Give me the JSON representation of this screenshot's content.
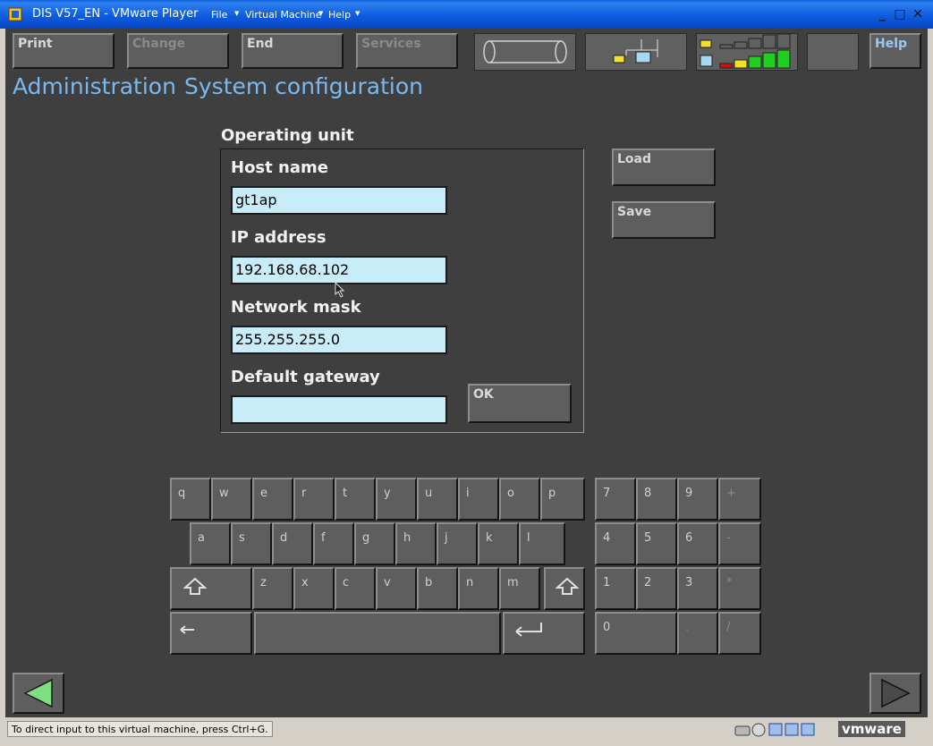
{
  "window": {
    "title": "DIS V57_EN - VMware Player",
    "menus": [
      "File",
      "Virtual Machine",
      "Help"
    ],
    "controls": {
      "minimize": "_",
      "maximize": "□",
      "close": "✕"
    }
  },
  "toolbar": {
    "print": "Print",
    "change": "Change",
    "end": "End",
    "services": "Services",
    "help": "Help"
  },
  "breadcrumb": {
    "section": "Administration",
    "page": "System configuration"
  },
  "form": {
    "group_title": "Operating unit",
    "host_name_label": "Host name",
    "host_name_value": "gt1ap",
    "ip_label": "IP address",
    "ip_value": "192.168.68.102",
    "mask_label": "Network mask",
    "mask_value": "255.255.255.0",
    "gateway_label": "Default gateway",
    "gateway_value": "",
    "ok": "OK"
  },
  "side_buttons": {
    "load": "Load",
    "save": "Save"
  },
  "keyboard": {
    "row1": [
      "q",
      "w",
      "e",
      "r",
      "t",
      "y",
      "u",
      "i",
      "o",
      "p"
    ],
    "row2": [
      "a",
      "s",
      "d",
      "f",
      "g",
      "h",
      "j",
      "k",
      "l"
    ],
    "row3": [
      "z",
      "x",
      "c",
      "v",
      "b",
      "n",
      "m"
    ],
    "numpad": [
      [
        "7",
        "8",
        "9",
        "+"
      ],
      [
        "4",
        "5",
        "6",
        "-"
      ],
      [
        "1",
        "2",
        "3",
        "*"
      ]
    ],
    "zero": "0",
    "dot": ".",
    "slash": "/"
  },
  "statusbar": {
    "hint": "To direct input to this virtual machine, press Ctrl+G.",
    "brand": "vmware"
  },
  "colors": {
    "titlebar": "#0d5de0",
    "background": "#3f3f3f",
    "accent_text": "#7cb8f0",
    "field_bg": "#c8ecf8"
  }
}
